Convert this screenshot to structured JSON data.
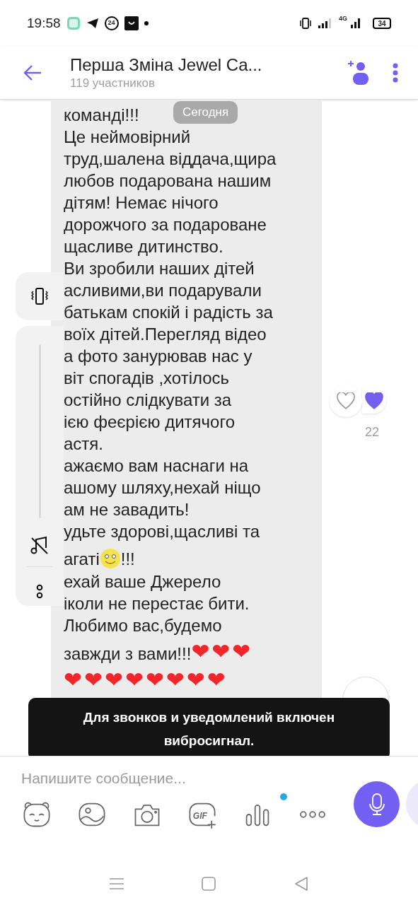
{
  "status_bar": {
    "time": "19:58",
    "badge_number": "24",
    "network": "4G",
    "battery": "34"
  },
  "header": {
    "title": "Перша Зміна Jewel Ca...",
    "subtitle": "119 участников"
  },
  "date_chip": "Сегодня",
  "message": {
    "lines": [
      {
        "kind": "text",
        "text": "команді!!!"
      },
      {
        "kind": "text",
        "text": "Це неймовірний"
      },
      {
        "kind": "text",
        "text": "труд,шалена віддача,щира"
      },
      {
        "kind": "text",
        "text": "любов подарована нашим"
      },
      {
        "kind": "text",
        "text": "дітям! Немає нічого"
      },
      {
        "kind": "text",
        "text": "дорожчого за подароване"
      },
      {
        "kind": "text",
        "text": "щасливе дитинство."
      },
      {
        "kind": "text",
        "text": "Ви зробили наших дітей"
      },
      {
        "kind": "text",
        "text": "асливими,ви подарували"
      },
      {
        "kind": "text",
        "text": "батькам спокій і радість за"
      },
      {
        "kind": "text",
        "text": "воїх дітей.Перегляд відео"
      },
      {
        "kind": "text",
        "text": "а фото занурював нас у"
      },
      {
        "kind": "text",
        "text": "віт спогадів ,хотілось"
      },
      {
        "kind": "text",
        "text": "остійно слідкувати за"
      },
      {
        "kind": "text",
        "text": "ією феєрією дитячого"
      },
      {
        "kind": "text",
        "text": "астя."
      },
      {
        "kind": "text",
        "text": "ажаємо вам наснаги на"
      },
      {
        "kind": "text",
        "text": "ашому шляху,нехай ніщо"
      },
      {
        "kind": "text",
        "text": "ам не завадить!"
      },
      {
        "kind": "text",
        "text": "удьте здорові,щасливі та"
      },
      {
        "kind": "smiley",
        "text": "агаті",
        "after": "!!!"
      },
      {
        "kind": "text",
        "text": "ехай ваше Джерело"
      },
      {
        "kind": "text",
        "text": "іколи не перестає бити."
      },
      {
        "kind": "text",
        "text": "Любимо вас,будемо"
      },
      {
        "kind": "hearts",
        "text": "завжди з вами!!!",
        "emoji": "❤❤❤"
      },
      {
        "kind": "hearts",
        "emoji": "❤❤❤❤❤❤❤❤"
      }
    ],
    "reaction": {
      "liked": false,
      "count": "22"
    }
  },
  "volume_panel": {
    "vibrate": true
  },
  "toast": "Для звонков и уведомлений включен вибросигнал.",
  "composer": {
    "placeholder": "Напишите сообщение..."
  },
  "toolbar": [
    {
      "kind": "sticker",
      "dot": false
    },
    {
      "kind": "gallery",
      "dot": false
    },
    {
      "kind": "camera",
      "dot": false
    },
    {
      "kind": "gif",
      "label": "GIF",
      "dot": false
    },
    {
      "kind": "poll",
      "dot": true
    },
    {
      "kind": "more",
      "dot": false
    }
  ]
}
